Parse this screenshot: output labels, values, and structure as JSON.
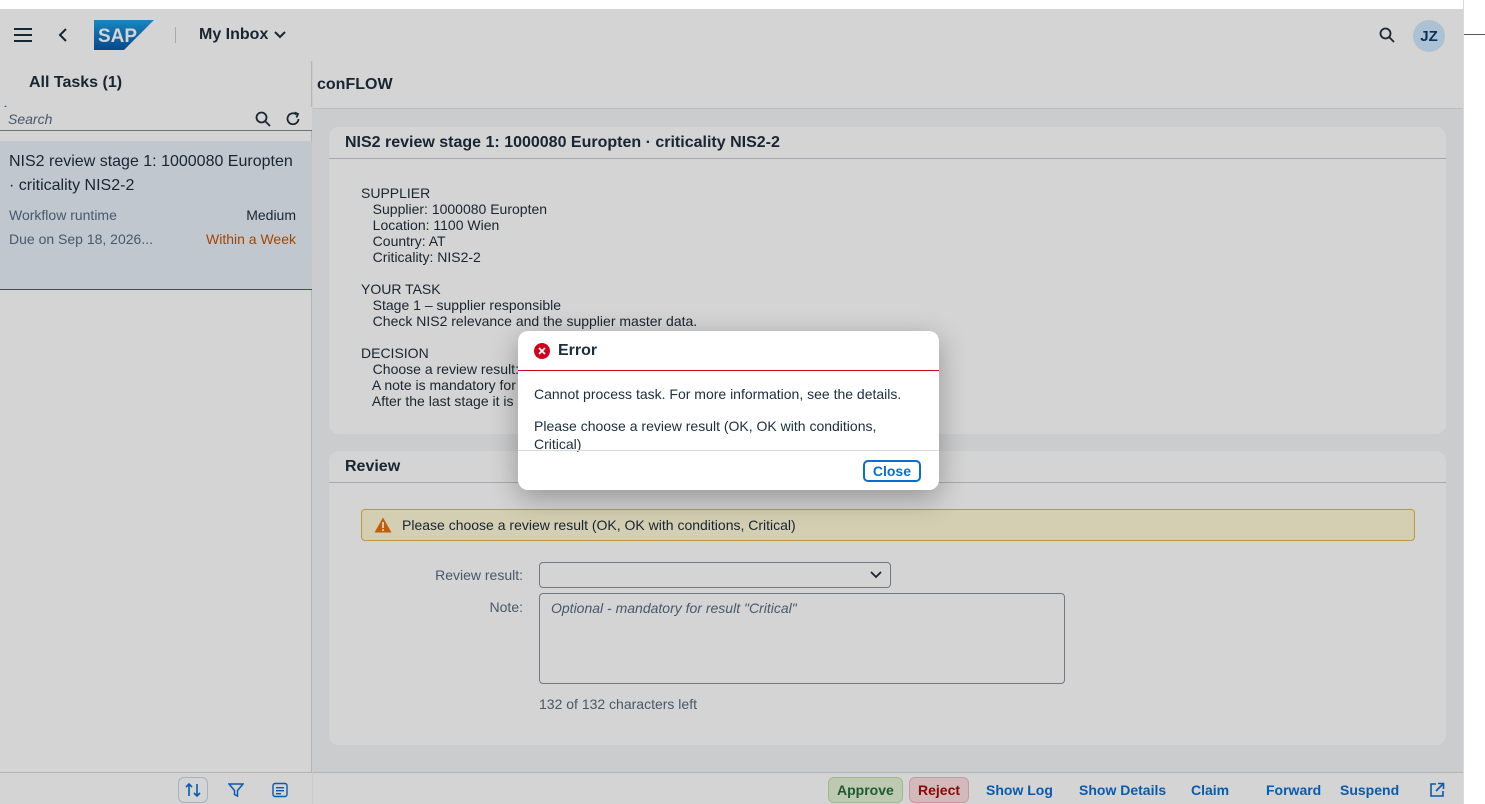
{
  "shell": {
    "logo_text": "SAP",
    "app_title": "My Inbox",
    "avatar_initials": "JZ"
  },
  "master": {
    "title": "All Tasks (1)",
    "search_placeholder": "Search",
    "task": {
      "title": "NIS2 review stage 1: 1000080 Europten · criticality NIS2-2",
      "workflow_label": "Workflow runtime",
      "priority": "Medium",
      "due": "Due on Sep 18, 2026...",
      "due_status": "Within a Week"
    }
  },
  "detail": {
    "header": "conFLOW",
    "task_card": {
      "title": "NIS2 review stage 1: 1000080 Europten · criticality NIS2-2",
      "description": "SUPPLIER\n   Supplier: 1000080 Europten\n   Location: 1100 Wien\n   Country: AT\n   Criticality: NIS2-2\n\nYOUR TASK\n   Stage 1 – supplier responsible\n   Check NIS2 relevance and the supplier master data.\n\nDECISION\n   Choose a review result:\n   A note is mandatory for\n   After the last stage it is"
    },
    "review_card": {
      "title": "Review",
      "warning": "Please choose a review result (OK, OK with conditions, Critical)",
      "review_result_label": "Review result:",
      "review_result_value": "",
      "note_label": "Note:",
      "note_placeholder": "Optional - mandatory for result \"Critical\"",
      "counter": "132 of 132 characters left"
    },
    "footer": {
      "approve": "Approve",
      "reject": "Reject",
      "show_log": "Show Log",
      "show_details": "Show Details",
      "claim": "Claim",
      "forward": "Forward",
      "suspend": "Suspend"
    }
  },
  "dialog": {
    "title": "Error",
    "message1": "Cannot process task. For more information, see the details.",
    "message2": "Please choose a review result (OK, OK with conditions, Critical)",
    "close_label": "Close"
  },
  "colors": {
    "accent": "#0a6ed1",
    "error": "#d1001a",
    "warning": "#e9730c",
    "success": "#256f3a"
  }
}
